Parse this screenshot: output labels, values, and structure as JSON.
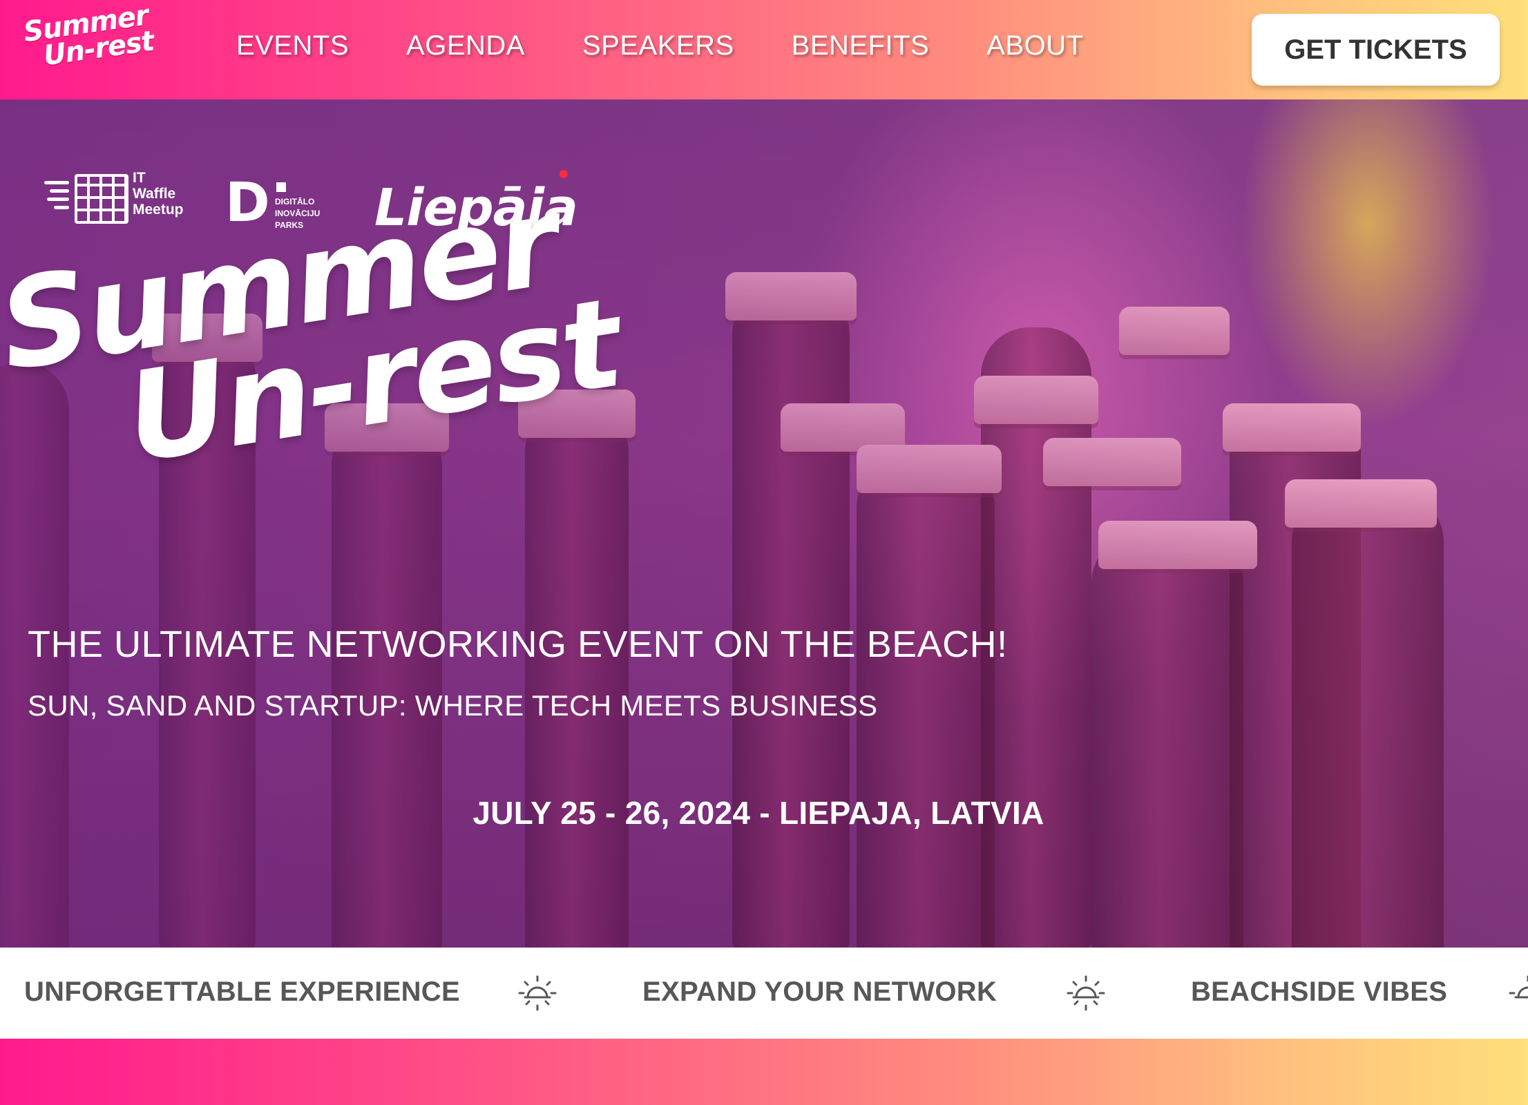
{
  "brand": {
    "line1": "Summer",
    "line2": "Un-rest"
  },
  "nav": {
    "items": [
      {
        "label": "EVENTS"
      },
      {
        "label": "AGENDA"
      },
      {
        "label": "SPEAKERS"
      },
      {
        "label": "BENEFITS"
      },
      {
        "label": "ABOUT"
      }
    ],
    "cta_label": "GET TICKETS"
  },
  "partners": {
    "waffle": {
      "line1": "IT",
      "line2": "Waffle",
      "line3": "Meetup"
    },
    "dip": {
      "letter": "D",
      "line1": "DIGITĀLO",
      "line2": "INOVĀCIJU",
      "line3": "PARKS"
    },
    "liepaja": "Liepāja"
  },
  "hero": {
    "title_line1": "Summer",
    "title_line2": "Un-rest",
    "tagline": "THE ULTIMATE NETWORKING EVENT ON THE BEACH!",
    "subtagline": "SUN, SAND AND STARTUP: WHERE TECH MEETS BUSINESS",
    "date_location": "JULY 25 - 26, 2024 - LIEPAJA, LATVIA"
  },
  "marquee": {
    "items": [
      "UNFORGETTABLE EXPERIENCE",
      "EXPAND YOUR NETWORK",
      "BEACHSIDE VIBES"
    ],
    "separator_icon": "sun-icon"
  },
  "colors": {
    "gradient_start": "#ff1a8c",
    "gradient_end": "#ffe07a",
    "hero_overlay": "#7a3a86",
    "marquee_text": "#575757"
  }
}
